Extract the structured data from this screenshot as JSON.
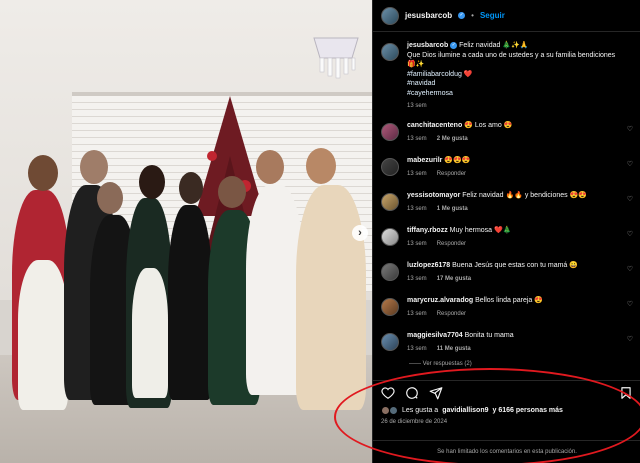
{
  "post": {
    "username": "jesusbarcob",
    "follow_label": "Seguir",
    "separator": "•"
  },
  "caption": {
    "username": "jesusbarcob",
    "line1": "Feliz navidad 🎄✨🙏",
    "line2": "Que Dios ilumine a cada uno de ustedes y a su familia bendiciones 🎁✨",
    "tag1": "#familiabarcoldug ❤️",
    "tag2": "#navidad",
    "tag3": "#cayehermosa",
    "time": "13 sem"
  },
  "comments": [
    {
      "username": "canchitacenteno",
      "text": "😍 Los amo 😍",
      "time": "13 sem",
      "likes": "2 Me gusta",
      "reply": ""
    },
    {
      "username": "mabezurilr",
      "text": "😍😍😍",
      "time": "13 sem",
      "likes": "",
      "reply": "Responder"
    },
    {
      "username": "yessisotomayor",
      "text": "Feliz navidad 🔥🔥 y bendiciones 😍😍",
      "time": "13 sem",
      "likes": "1 Me gusta",
      "reply": "Responder"
    },
    {
      "username": "tiffany.rbozz",
      "text": "Muy hermosa ❤️🎄",
      "time": "13 sem",
      "likes": "",
      "reply": "Responder"
    },
    {
      "username": "luzlopez6178",
      "text": "Buena Jesús que estas con tu mamá 😀",
      "time": "13 sem",
      "likes": "17 Me gusta",
      "reply": "Responder"
    },
    {
      "username": "marycruz.alvaradog",
      "text": "Bellos linda pareja 😍",
      "time": "13 sem",
      "likes": "",
      "reply": "Responder"
    },
    {
      "username": "maggiesilva7704",
      "text": "Bonita tu mama",
      "time": "13 sem",
      "likes": "11 Me gusta",
      "reply": "Responder"
    }
  ],
  "view_replies": "—— Ver respuestas (2)",
  "likes_summary": {
    "prefix": "Les gusta a",
    "user": "gavidiallison9",
    "suffix": "y 6166 personas más"
  },
  "post_date": "26 de diciembre de 2024",
  "comments_limited": "Se han limitado los comentarios en esta publicación.",
  "icons": {
    "like": "heart-icon",
    "comment": "comment-icon",
    "share": "send-icon",
    "save": "bookmark-icon",
    "next": "chevron-right-icon"
  },
  "colors": {
    "accent_blue": "#0095f6",
    "annotation_red": "#e0191f",
    "verified_blue": "#3897f0"
  }
}
